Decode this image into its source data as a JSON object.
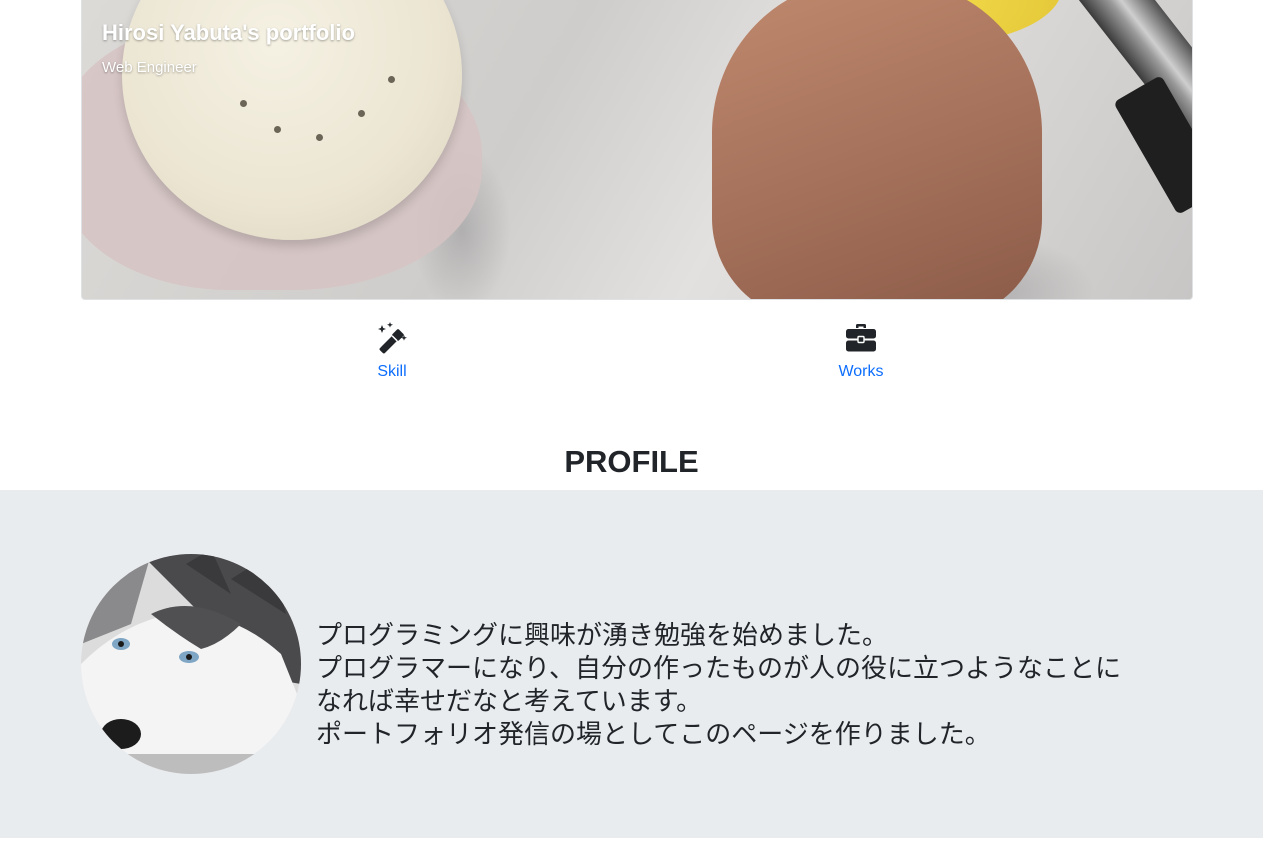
{
  "header": {
    "title": "Hirosi Yabuta's portfolio",
    "subtitle": "Web Engineer"
  },
  "nav": {
    "items": [
      {
        "label": "Skill",
        "icon": "magic-wand-icon"
      },
      {
        "label": "Works",
        "icon": "briefcase-icon"
      }
    ]
  },
  "profile": {
    "heading": "PROFILE",
    "avatar": "husky-dog-photo",
    "lines": [
      "プログラミングに興味が湧き勉強を始めました。",
      "プログラマーになり、自分の作ったものが人の役に立つようなことに",
      "なれば幸せだなと考えています。",
      "ポートフォリオ発信の場としてこのページを作りました。"
    ]
  },
  "colors": {
    "link": "#0d6efd",
    "profile_bg": "#e9ecef",
    "text": "#212529",
    "icon": "#212529"
  }
}
